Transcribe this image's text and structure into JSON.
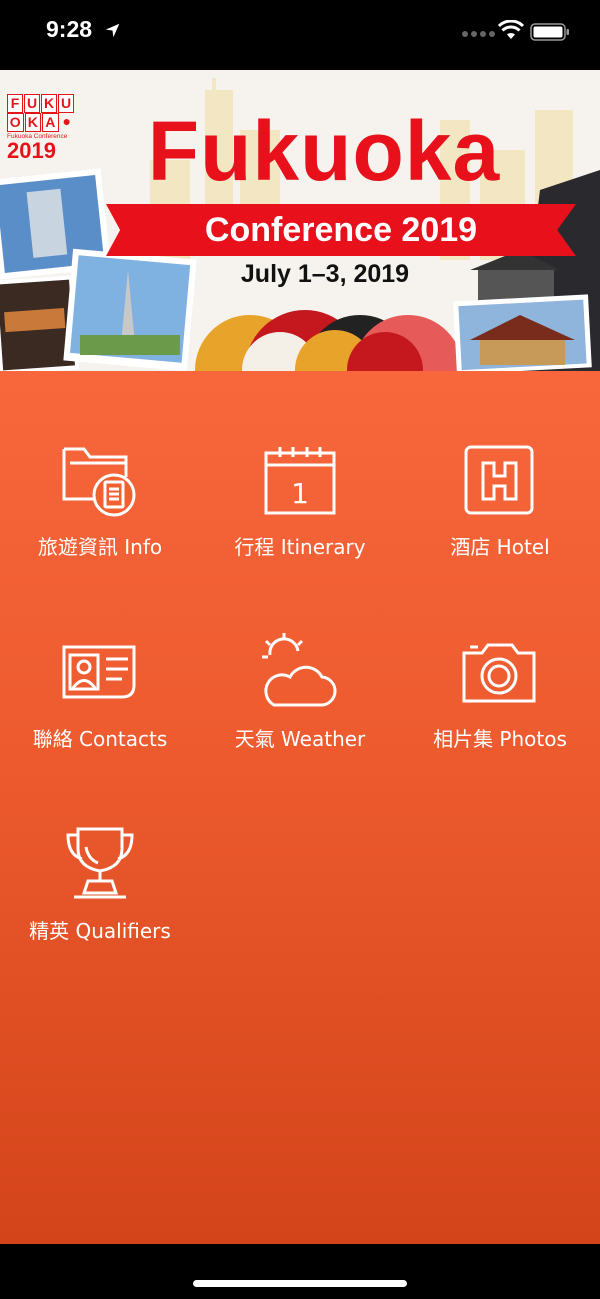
{
  "status_bar": {
    "time": "9:28",
    "icons": [
      "location-arrow-icon",
      "cellular-signal-icon",
      "wifi-icon",
      "battery-icon"
    ]
  },
  "banner": {
    "logo_letters_row1": [
      "F",
      "U",
      "K",
      "U"
    ],
    "logo_letters_row2": [
      "O",
      "K",
      "A"
    ],
    "logo_subtitle": "Fukuoka Conference",
    "logo_year": "2019",
    "title": "Fukuoka",
    "subtitle": "Conference 2019",
    "dates": "July 1–3, 2019"
  },
  "menu": {
    "items": [
      {
        "label": "旅遊資訊 Info",
        "icon": "folder-document-icon"
      },
      {
        "label": "行程 Itinerary",
        "icon": "calendar-icon",
        "calendar_day": "1"
      },
      {
        "label": "酒店 Hotel",
        "icon": "hotel-icon",
        "hotel_letter": "H"
      },
      {
        "label": "聯絡 Contacts",
        "icon": "contact-card-icon"
      },
      {
        "label": "天氣 Weather",
        "icon": "weather-partly-sunny-icon"
      },
      {
        "label": "相片集 Photos",
        "icon": "camera-icon"
      },
      {
        "label": "精英 Qualifiers",
        "icon": "trophy-icon"
      }
    ]
  },
  "colors": {
    "gradient_top": "#f8673c",
    "gradient_bottom": "#d4441a",
    "brand_red": "#e8101a"
  }
}
